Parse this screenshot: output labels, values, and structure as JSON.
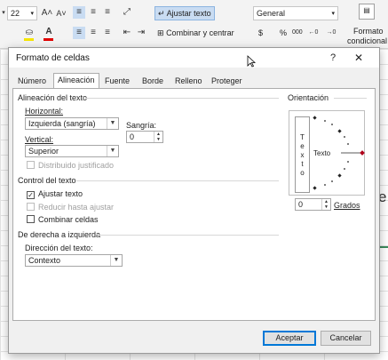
{
  "ribbon": {
    "font_size": "22",
    "grow_font": "A˄",
    "shrink_font": "A˅",
    "wrap_text": "Ajustar texto",
    "merge_center": "Combinar y centrar",
    "number_format": "General",
    "currency": "$",
    "percent": "%",
    "thousands": "000",
    "cond_format_line1": "Formato",
    "cond_format_line2": "condicional"
  },
  "sheet": {
    "cell_letter": "e"
  },
  "dialog": {
    "title": "Formato de celdas",
    "help": "?",
    "close": "✕",
    "tabs": [
      {
        "label": "Número"
      },
      {
        "label": "Alineación",
        "active": true
      },
      {
        "label": "Fuente"
      },
      {
        "label": "Borde"
      },
      {
        "label": "Relleno"
      },
      {
        "label": "Proteger"
      }
    ],
    "alignment": {
      "section": "Alineación del texto",
      "horizontal_label": "Horizontal:",
      "horizontal_value": "Izquierda (sangría)",
      "indent_label": "Sangría:",
      "indent_value": "0",
      "vertical_label": "Vertical:",
      "vertical_value": "Superior",
      "distributed_justify": "Distribuido justificado"
    },
    "text_control": {
      "section": "Control del texto",
      "wrap_text": "Ajustar texto",
      "wrap_checked": true,
      "shrink_to_fit": "Reducir hasta ajustar",
      "merge_cells": "Combinar celdas"
    },
    "rtl": {
      "section": "De derecha a izquierda",
      "direction_label": "Dirección del texto:",
      "direction_value": "Contexto"
    },
    "orientation": {
      "section": "Orientación",
      "vertical_text": "T\ne\nx\nt\no",
      "dial_text": "Texto",
      "degrees_value": "0",
      "degrees_label": "Grados"
    },
    "ok": "Aceptar",
    "cancel": "Cancelar"
  }
}
